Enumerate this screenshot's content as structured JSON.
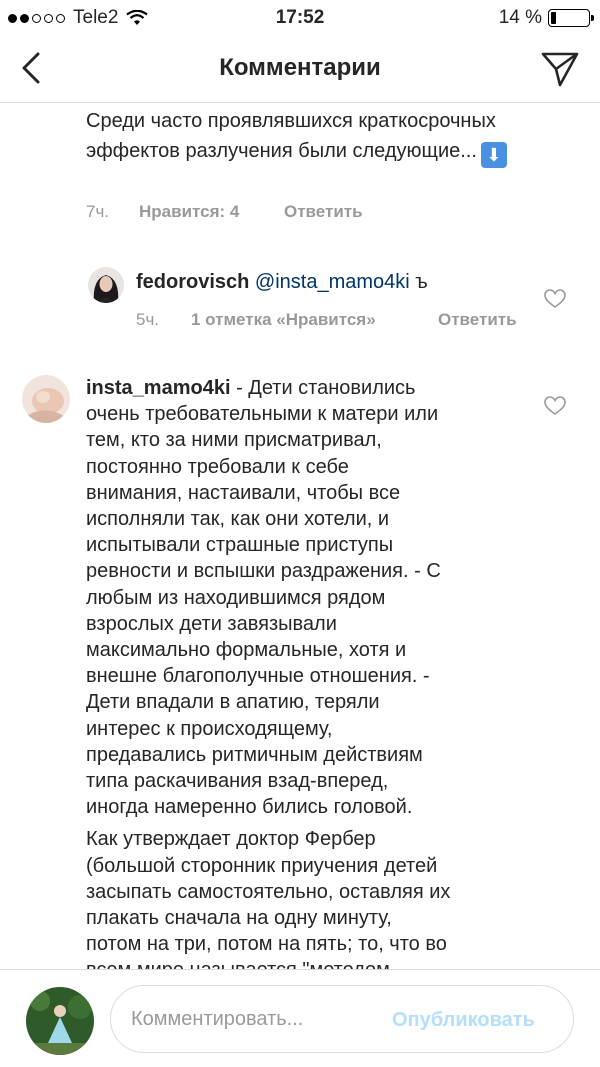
{
  "status_bar": {
    "carrier": "Tele2",
    "time": "17:52",
    "battery": "14 %",
    "battery_level": 0.14
  },
  "header": {
    "title": "Комментарии"
  },
  "caption": {
    "text": "Среди часто проявлявшихся краткосрочных эффектов разлучения были следующие...",
    "time": "7ч.",
    "likes": "Нравится: 4",
    "reply": "Ответить"
  },
  "reply_comment": {
    "username": "fedorovisch",
    "mention": "@insta_mamo4ki",
    "text": "ъ",
    "time": "5ч.",
    "likes": "1 отметка «Нравится»",
    "reply": "Ответить"
  },
  "main_comment": {
    "username": "insta_mamo4ki",
    "lines": [
      " - Дети становились",
      "очень требовательными к матери или",
      "тем, кто за ними присматривал,",
      "постоянно требовали к себе",
      "внимания, настаивали, чтобы все",
      "исполняли так, как они хотели, и",
      "испытывали страшные приступы",
      "ревности и вспышки раздражения. - С",
      "любым из находившимся рядом",
      "взрослых дети завязывали",
      "максимально формальные, хотя и",
      "внешне благополучные отношения. -",
      "Дети впадали в апатию, теряли",
      "интерес к происходящему,",
      "предавались ритмичным действиям",
      "типа раскачивания взад-вперед,",
      "иногда намеренно бились головой."
    ],
    "lines2": [
      "Как утверждает доктор Фербер",
      "(большой сторонник приучения детей",
      "засыпать самостоятельно, оставляя их",
      "плакать сначала на одну минуту,",
      "потом на три, потом на пять; то, что во",
      "всем мире называется \"методом"
    ]
  },
  "comment_bar": {
    "placeholder": "Комментировать...",
    "publish": "Опубликовать"
  }
}
